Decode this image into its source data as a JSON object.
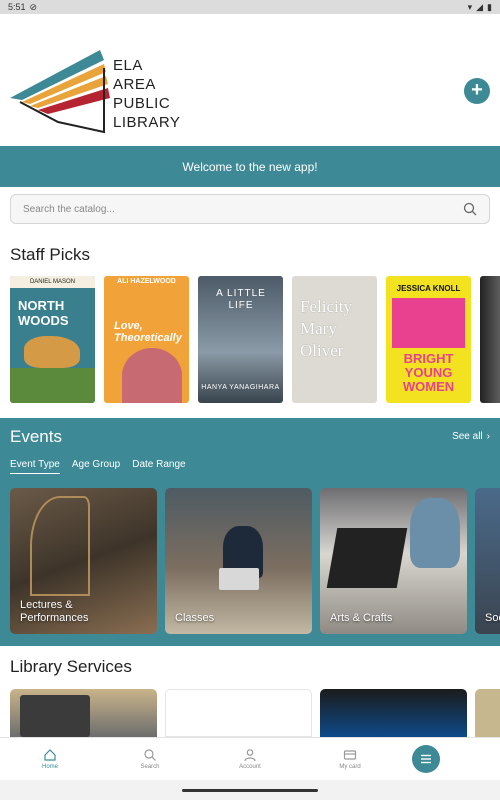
{
  "status_bar": {
    "time": "5:51"
  },
  "header": {
    "logo_lines": [
      "ELA",
      "AREA",
      "PUBLIC",
      "LIBRARY"
    ],
    "add_icon": "plus-icon"
  },
  "welcome": "Welcome to the new app!",
  "search": {
    "placeholder": "Search the catalog..."
  },
  "staff_picks": {
    "title": "Staff Picks",
    "books": [
      {
        "lines": [
          "NORTH",
          "WOODS"
        ],
        "author": "DANIEL MASON",
        "color": "#3a7f8e"
      },
      {
        "lines": [
          "Love,",
          "Theoretically"
        ],
        "author": "ALI HAZELWOOD",
        "color": "#f1a33a"
      },
      {
        "lines": [
          "A LITTLE",
          "LIFE"
        ],
        "author": "HANYA YANAGIHARA",
        "color": "#5a6a78"
      },
      {
        "lines": [
          "Felicity",
          "Mary",
          "Oliver"
        ],
        "author": "",
        "color": "#d9d7cf"
      },
      {
        "lines": [
          "BRIGHT",
          "YOUNG",
          "WOMEN"
        ],
        "author": "JESSICA KNOLL",
        "color": "#f2e21f"
      },
      {
        "lines": [],
        "author": "",
        "color": "#2b2b2b"
      }
    ]
  },
  "events": {
    "title": "Events",
    "see_all": "See all",
    "filters": [
      "Event Type",
      "Age Group",
      "Date Range"
    ],
    "cards": [
      {
        "label": "Lectures & Performances"
      },
      {
        "label": "Classes"
      },
      {
        "label": "Arts & Crafts"
      },
      {
        "label": "Soc"
      }
    ]
  },
  "services": {
    "title": "Library Services"
  },
  "nav": {
    "items": [
      {
        "label": "Home",
        "icon": "home-icon"
      },
      {
        "label": "Search",
        "icon": "search-icon"
      },
      {
        "label": "Account",
        "icon": "user-icon"
      },
      {
        "label": "My card",
        "icon": "card-icon"
      }
    ],
    "menu_icon": "menu-icon"
  },
  "colors": {
    "teal": "#3d8a96"
  }
}
